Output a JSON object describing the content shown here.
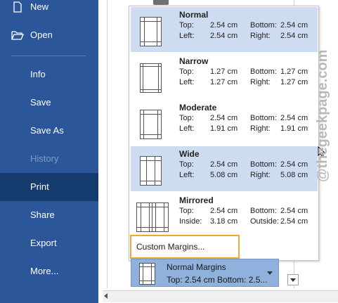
{
  "sidebar": {
    "items": [
      {
        "label": "New",
        "icon": "new-document-icon"
      },
      {
        "label": "Open",
        "icon": "folder-open-icon"
      },
      {
        "label": "Info"
      },
      {
        "label": "Save"
      },
      {
        "label": "Save As"
      },
      {
        "label": "History",
        "disabled": true
      },
      {
        "label": "Print",
        "selected": true
      },
      {
        "label": "Share"
      },
      {
        "label": "Export"
      },
      {
        "label": "More..."
      }
    ]
  },
  "margins": {
    "options": [
      {
        "name": "Normal",
        "highlighted": true,
        "r1": {
          "la": "Top:",
          "va": "2.54 cm",
          "lb": "Bottom:",
          "vb": "2.54 cm"
        },
        "r2": {
          "la": "Left:",
          "va": "2.54 cm",
          "lb": "Right:",
          "vb": "2.54 cm"
        }
      },
      {
        "name": "Narrow",
        "r1": {
          "la": "Top:",
          "va": "1.27 cm",
          "lb": "Bottom:",
          "vb": "1.27 cm"
        },
        "r2": {
          "la": "Left:",
          "va": "1.27 cm",
          "lb": "Right:",
          "vb": "1.27 cm"
        }
      },
      {
        "name": "Moderate",
        "r1": {
          "la": "Top:",
          "va": "2.54 cm",
          "lb": "Bottom:",
          "vb": "2.54 cm"
        },
        "r2": {
          "la": "Left:",
          "va": "1.91 cm",
          "lb": "Right:",
          "vb": "1.91 cm"
        }
      },
      {
        "name": "Wide",
        "highlighted": true,
        "r1": {
          "la": "Top:",
          "va": "2.54 cm",
          "lb": "Bottom:",
          "vb": "2.54 cm"
        },
        "r2": {
          "la": "Left:",
          "va": "5.08 cm",
          "lb": "Right:",
          "vb": "5.08 cm"
        }
      },
      {
        "name": "Mirrored",
        "r1": {
          "la": "Top:",
          "va": "2.54 cm",
          "lb": "Bottom:",
          "vb": "2.54 cm"
        },
        "r2": {
          "la": "Inside:",
          "va": "3.18 cm",
          "lb": "Outside:",
          "vb": "2.54 cm"
        }
      }
    ],
    "custom_label": "Custom Margins...",
    "current": {
      "title": "Normal Margins",
      "summary": "Top: 2.54 cm Bottom: 2.5..."
    }
  },
  "watermark": "@thegeekpage.com",
  "colors": {
    "sidebar": "#2b579a",
    "sidebar_selected": "#143a6e",
    "highlight": "#cddcf0",
    "custom_border": "#f0a830",
    "selector": "#8fb1dc"
  }
}
